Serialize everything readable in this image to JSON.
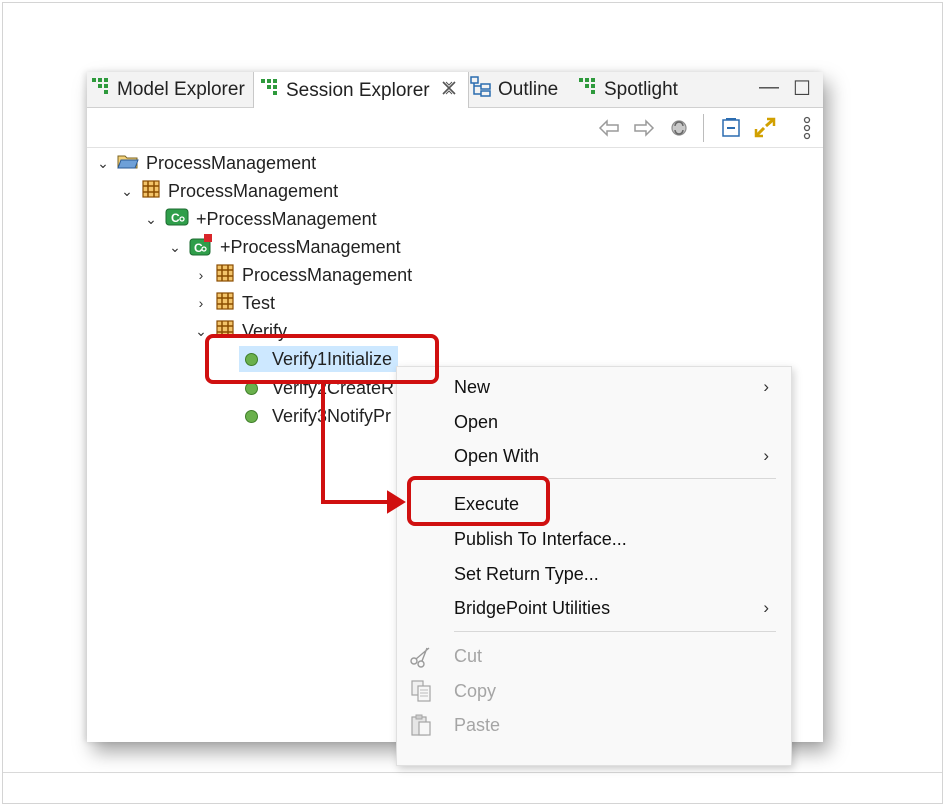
{
  "tabs": [
    {
      "label": "Model Explorer",
      "icon": "grid-icon"
    },
    {
      "label": "Session Explorer",
      "icon": "grid-icon",
      "active": true,
      "close": "close-icon"
    },
    {
      "label": "Outline",
      "icon": "outline-icon"
    },
    {
      "label": "Spotlight",
      "icon": "grid-icon"
    }
  ],
  "window_controls": {
    "minimize": "—",
    "maximize": "☐"
  },
  "toolbar": {
    "back_icon": "back-arrow-icon",
    "forward_icon": "forward-arrow-icon",
    "refresh_icon": "refresh-icon",
    "collapse_icon": "collapse-all-icon",
    "link_icon": "link-editor-icon",
    "menu_icon": "view-menu-icon"
  },
  "tree": [
    {
      "label": "ProcessManagement",
      "expanded": true,
      "icon": "project-folder-icon"
    },
    {
      "label": "ProcessManagement",
      "expanded": true,
      "icon": "package-icon"
    },
    {
      "label": "+ProcessManagement",
      "expanded": true,
      "icon": "component-icon"
    },
    {
      "label": "+ProcessManagement",
      "expanded": true,
      "icon": "component-reference-icon"
    },
    {
      "label": "ProcessManagement",
      "expanded": false,
      "icon": "package-icon"
    },
    {
      "label": "Test",
      "expanded": false,
      "icon": "package-icon"
    },
    {
      "label": "Verify",
      "expanded": true,
      "icon": "package-icon"
    },
    {
      "label": "Verify1Initialize",
      "selected": true,
      "icon": "function-icon"
    },
    {
      "label": "Verify2CreateR",
      "icon": "function-icon"
    },
    {
      "label": "Verify3NotifyPr",
      "icon": "function-icon"
    }
  ],
  "context_menu": {
    "items": [
      {
        "label": "New",
        "submenu": true
      },
      {
        "label": "Open"
      },
      {
        "label": "Open With",
        "submenu": true
      },
      {
        "label": "Execute",
        "highlighted": true
      },
      {
        "label": "Publish To Interface..."
      },
      {
        "label": "Set Return Type..."
      },
      {
        "label": "BridgePoint Utilities",
        "submenu": true
      },
      {
        "label": "Cut",
        "disabled": true,
        "icon": "scissors-icon"
      },
      {
        "label": "Copy",
        "disabled": true,
        "icon": "copy-icon"
      },
      {
        "label": "Paste",
        "disabled": true,
        "icon": "paste-icon"
      }
    ],
    "submenu_arrow": "›"
  },
  "annotation_color": "#d01010"
}
